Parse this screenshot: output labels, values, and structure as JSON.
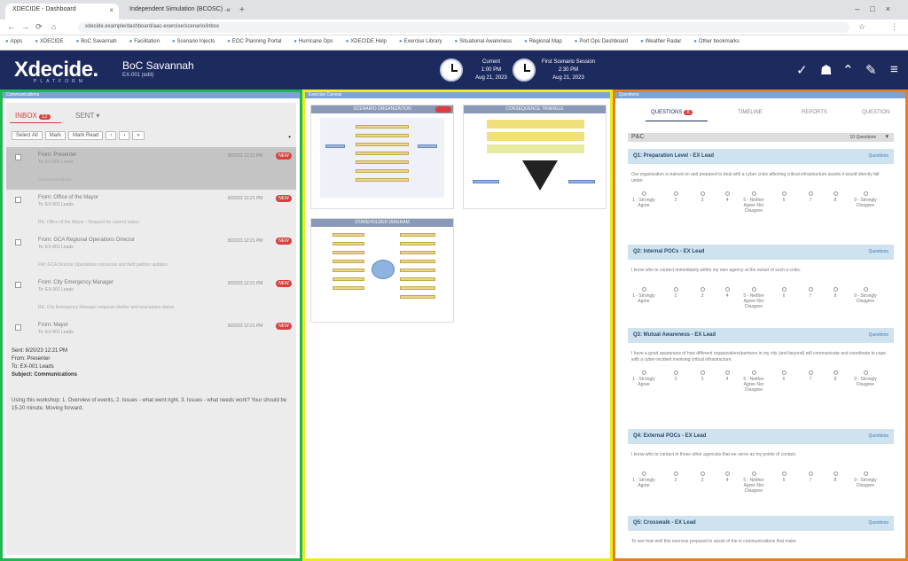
{
  "browser": {
    "tabs": [
      "XDECIDE - Dashboard",
      "Independent Simulation (BCOSC) ..."
    ],
    "url": "xdecide.example/dashboard/aac-exercise/scenario/inbox",
    "bookmarks": [
      "Apps",
      "XDECIDE",
      "BoC Savannah",
      "Facilitation",
      "Scenario Injects",
      "EOC Planning Portal",
      "Hurricane Ops",
      "XDECIDE Help",
      "Exercise Library",
      "Situational Awareness",
      "Regional Map",
      "Port Ops Dashboard",
      "Weather Radar",
      "Other bookmarks"
    ]
  },
  "header": {
    "logo": "Xdecide.",
    "logo_sub": "PLATFORM",
    "entity_name": "BoC Savannah",
    "entity_sub": "EX-001 (edit)",
    "clock1_title": "Current",
    "clock1_time": "1:00 PM",
    "clock1_date": "Aug 21, 2023",
    "clock2_title": "First Scenario Session",
    "clock2_time": "2:30 PM",
    "clock2_date": "Aug 21, 2023"
  },
  "inbox": {
    "strip": "Communications",
    "tab_inbox": "INBOX",
    "inbox_count": "12",
    "tab_sent": "SENT",
    "toolbar": [
      "Select All",
      "Mark",
      "Mark Read",
      "‹",
      "›",
      "»"
    ],
    "messages": [
      {
        "from": "From: Presenter",
        "to": "To: EX-001 Leads",
        "time": "8/20/23 12:21 PM",
        "new": "NEW",
        "preview": "Communications"
      },
      {
        "from": "From: Office of the Mayor",
        "to": "To: EX-001 Leads",
        "time": "8/20/23 12:21 PM",
        "new": "NEW",
        "preview": "RE: Office of the Mayor - Request for current status"
      },
      {
        "from": "From: GCA Regional Operations Director",
        "to": "To: EX-001 Leads",
        "time": "8/20/23 12:21 PM",
        "new": "NEW",
        "preview": "FW: GCA Director Operations resources and field partner updates"
      },
      {
        "from": "From: City Emergency Manager",
        "to": "To: EX-001 Leads",
        "time": "8/20/23 12:21 PM",
        "new": "NEW",
        "preview": "RE: City Emergency Manager requests shelter and evacuation status"
      },
      {
        "from": "From: Mayor",
        "to": "To: EX-001 Leads",
        "time": "8/20/23 12:21 PM",
        "new": "NEW",
        "preview": ""
      }
    ],
    "detail_sent": "Sent: 8/20/23 12:21 PM",
    "detail_from": "From: Presenter",
    "detail_to": "To: EX-001 Leads",
    "detail_subject": "Subject: Communications",
    "body": "Using this workshop: 1. Overview of events, 2. Issues - what went right, 3. Issues - what needs work? Your should be 15-20 minute. Moving forward."
  },
  "canvas": {
    "strip": "Exercise Canvas",
    "cards": [
      {
        "title": "SCENARIO ORGANIZATION"
      },
      {
        "title": "CONSEQUENCE TRIANGLE"
      },
      {
        "title": "STAKEHOLDER DIAGRAM"
      }
    ]
  },
  "questions": {
    "strip": "Questions",
    "tabs": [
      "QUESTIONS",
      "TIMELINE",
      "REPORTS",
      "QUESTION"
    ],
    "q_count": "8",
    "group": "P&C",
    "group_meta": "10 Questions",
    "scale": [
      "1 - Strongly Agree",
      "2",
      "3",
      "4",
      "5 - Neither Agree Nor Disagree",
      "6",
      "7",
      "8",
      "9 - Strongly Disagree"
    ],
    "items": [
      {
        "title": "Q1: Preparation Level - EX Lead",
        "answer": "Questions",
        "text": "Our organization is trained on and prepared to deal with a cyber crisis affecting critical infrastructure assets it would directly fall under."
      },
      {
        "title": "Q2: Internal POCs - EX Lead",
        "answer": "Questions",
        "text": "I know who to contact immediately within my own agency at the outset of such a crisis."
      },
      {
        "title": "Q3: Mutual Awareness - EX Lead",
        "answer": "Questions",
        "text": "I have a good awareness of how different organizations/partners in my city (and beyond) will communicate and coordinate to cope with a cyber-incident involving critical infrastructure."
      },
      {
        "title": "Q4: External POCs - EX Lead",
        "answer": "Questions",
        "text": "I know who to contact in those other agencies that we serve as my points of contact."
      },
      {
        "title": "Q5: Crosswalk - EX Lead",
        "answer": "Questions",
        "text": "To see how well this exercise prepared to assist of the in communications that make"
      }
    ]
  }
}
